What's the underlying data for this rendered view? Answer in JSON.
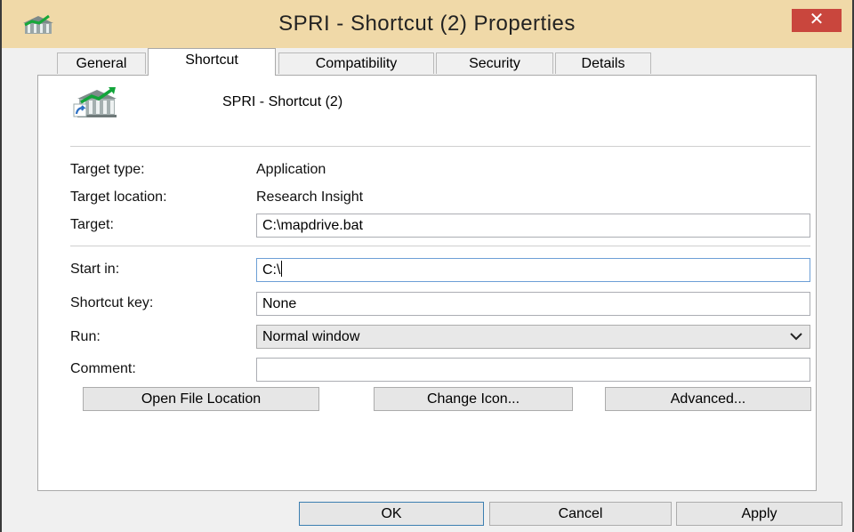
{
  "window": {
    "title": "SPRI - Shortcut (2) Properties",
    "close_glyph": "✕"
  },
  "tabs": [
    {
      "label": "General"
    },
    {
      "label": "Shortcut"
    },
    {
      "label": "Compatibility"
    },
    {
      "label": "Security"
    },
    {
      "label": "Details"
    }
  ],
  "active_tab": "Shortcut",
  "shortcut": {
    "name": "SPRI - Shortcut (2)",
    "icon": "bank-building-chart-icon",
    "target_type_label": "Target type:",
    "target_type_value": "Application",
    "target_location_label": "Target location:",
    "target_location_value": "Research Insight",
    "target_label": "Target:",
    "target_value": "C:\\mapdrive.bat",
    "start_in_label": "Start in:",
    "start_in_value": "C:\\",
    "shortcut_key_label": "Shortcut key:",
    "shortcut_key_value": "None",
    "run_label": "Run:",
    "run_value": "Normal window",
    "comment_label": "Comment:",
    "comment_value": ""
  },
  "panel_buttons": {
    "open_file_location": "Open File Location",
    "change_icon": "Change Icon...",
    "advanced": "Advanced..."
  },
  "footer": {
    "ok": "OK",
    "cancel": "Cancel",
    "apply": "Apply"
  },
  "colors": {
    "titlebar": "#f0d9a8",
    "close": "#c9463d",
    "focus_border": "#6d9fd6"
  }
}
